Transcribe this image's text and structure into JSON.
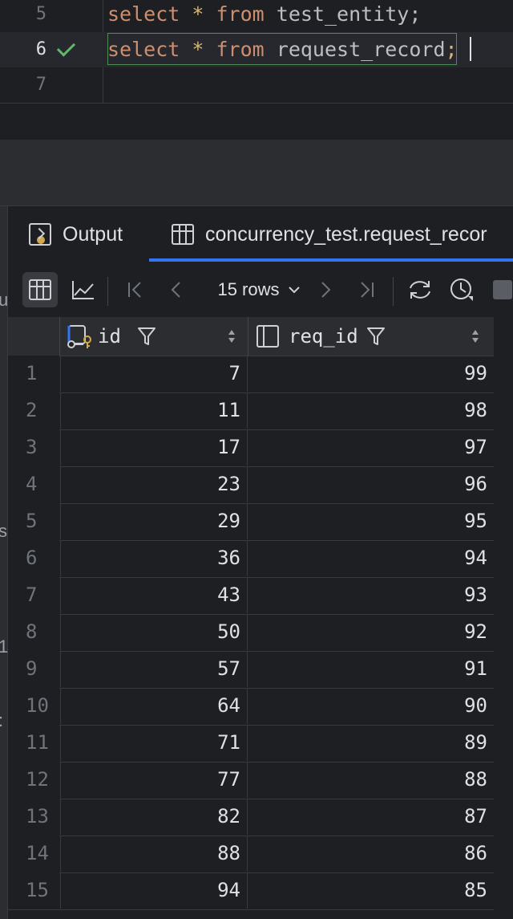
{
  "editor": {
    "lines": [
      {
        "num": "5",
        "kw1": "select",
        "op": "*",
        "kw2": "from",
        "table": "test_entity",
        "end": ";"
      },
      {
        "num": "6",
        "kw1": "select",
        "op": "*",
        "kw2": "from",
        "table": "request_record",
        "end": ";"
      },
      {
        "num": "7"
      }
    ]
  },
  "left_strip_glyphs": [
    "u",
    "s",
    "1",
    ":"
  ],
  "tabs": [
    {
      "label": "Output",
      "icon": "output-icon"
    },
    {
      "label": "concurrency_test.request_recor",
      "icon": "table-icon"
    }
  ],
  "toolbar": {
    "rows_label": "15 rows",
    "icons": [
      "table-view-icon",
      "chart-icon",
      "first-page-icon",
      "previous-page-icon",
      "next-page-icon",
      "last-page-icon",
      "refresh-icon",
      "history-icon",
      "stop-icon"
    ]
  },
  "grid": {
    "columns": [
      {
        "name": "id",
        "icon": "primary-key-icon"
      },
      {
        "name": "req_id",
        "icon": "column-icon"
      }
    ],
    "rows": [
      [
        "1",
        "7",
        "99"
      ],
      [
        "2",
        "11",
        "98"
      ],
      [
        "3",
        "17",
        "97"
      ],
      [
        "4",
        "23",
        "96"
      ],
      [
        "5",
        "29",
        "95"
      ],
      [
        "6",
        "36",
        "94"
      ],
      [
        "7",
        "43",
        "93"
      ],
      [
        "8",
        "50",
        "92"
      ],
      [
        "9",
        "57",
        "91"
      ],
      [
        "10",
        "64",
        "90"
      ],
      [
        "11",
        "71",
        "89"
      ],
      [
        "12",
        "77",
        "88"
      ],
      [
        "13",
        "82",
        "87"
      ],
      [
        "14",
        "88",
        "86"
      ],
      [
        "15",
        "94",
        "85"
      ]
    ]
  },
  "colors": {
    "keyword": "#cf8e6d",
    "operator": "#d5b778",
    "success": "#5fb865",
    "accent": "#3574f0"
  }
}
